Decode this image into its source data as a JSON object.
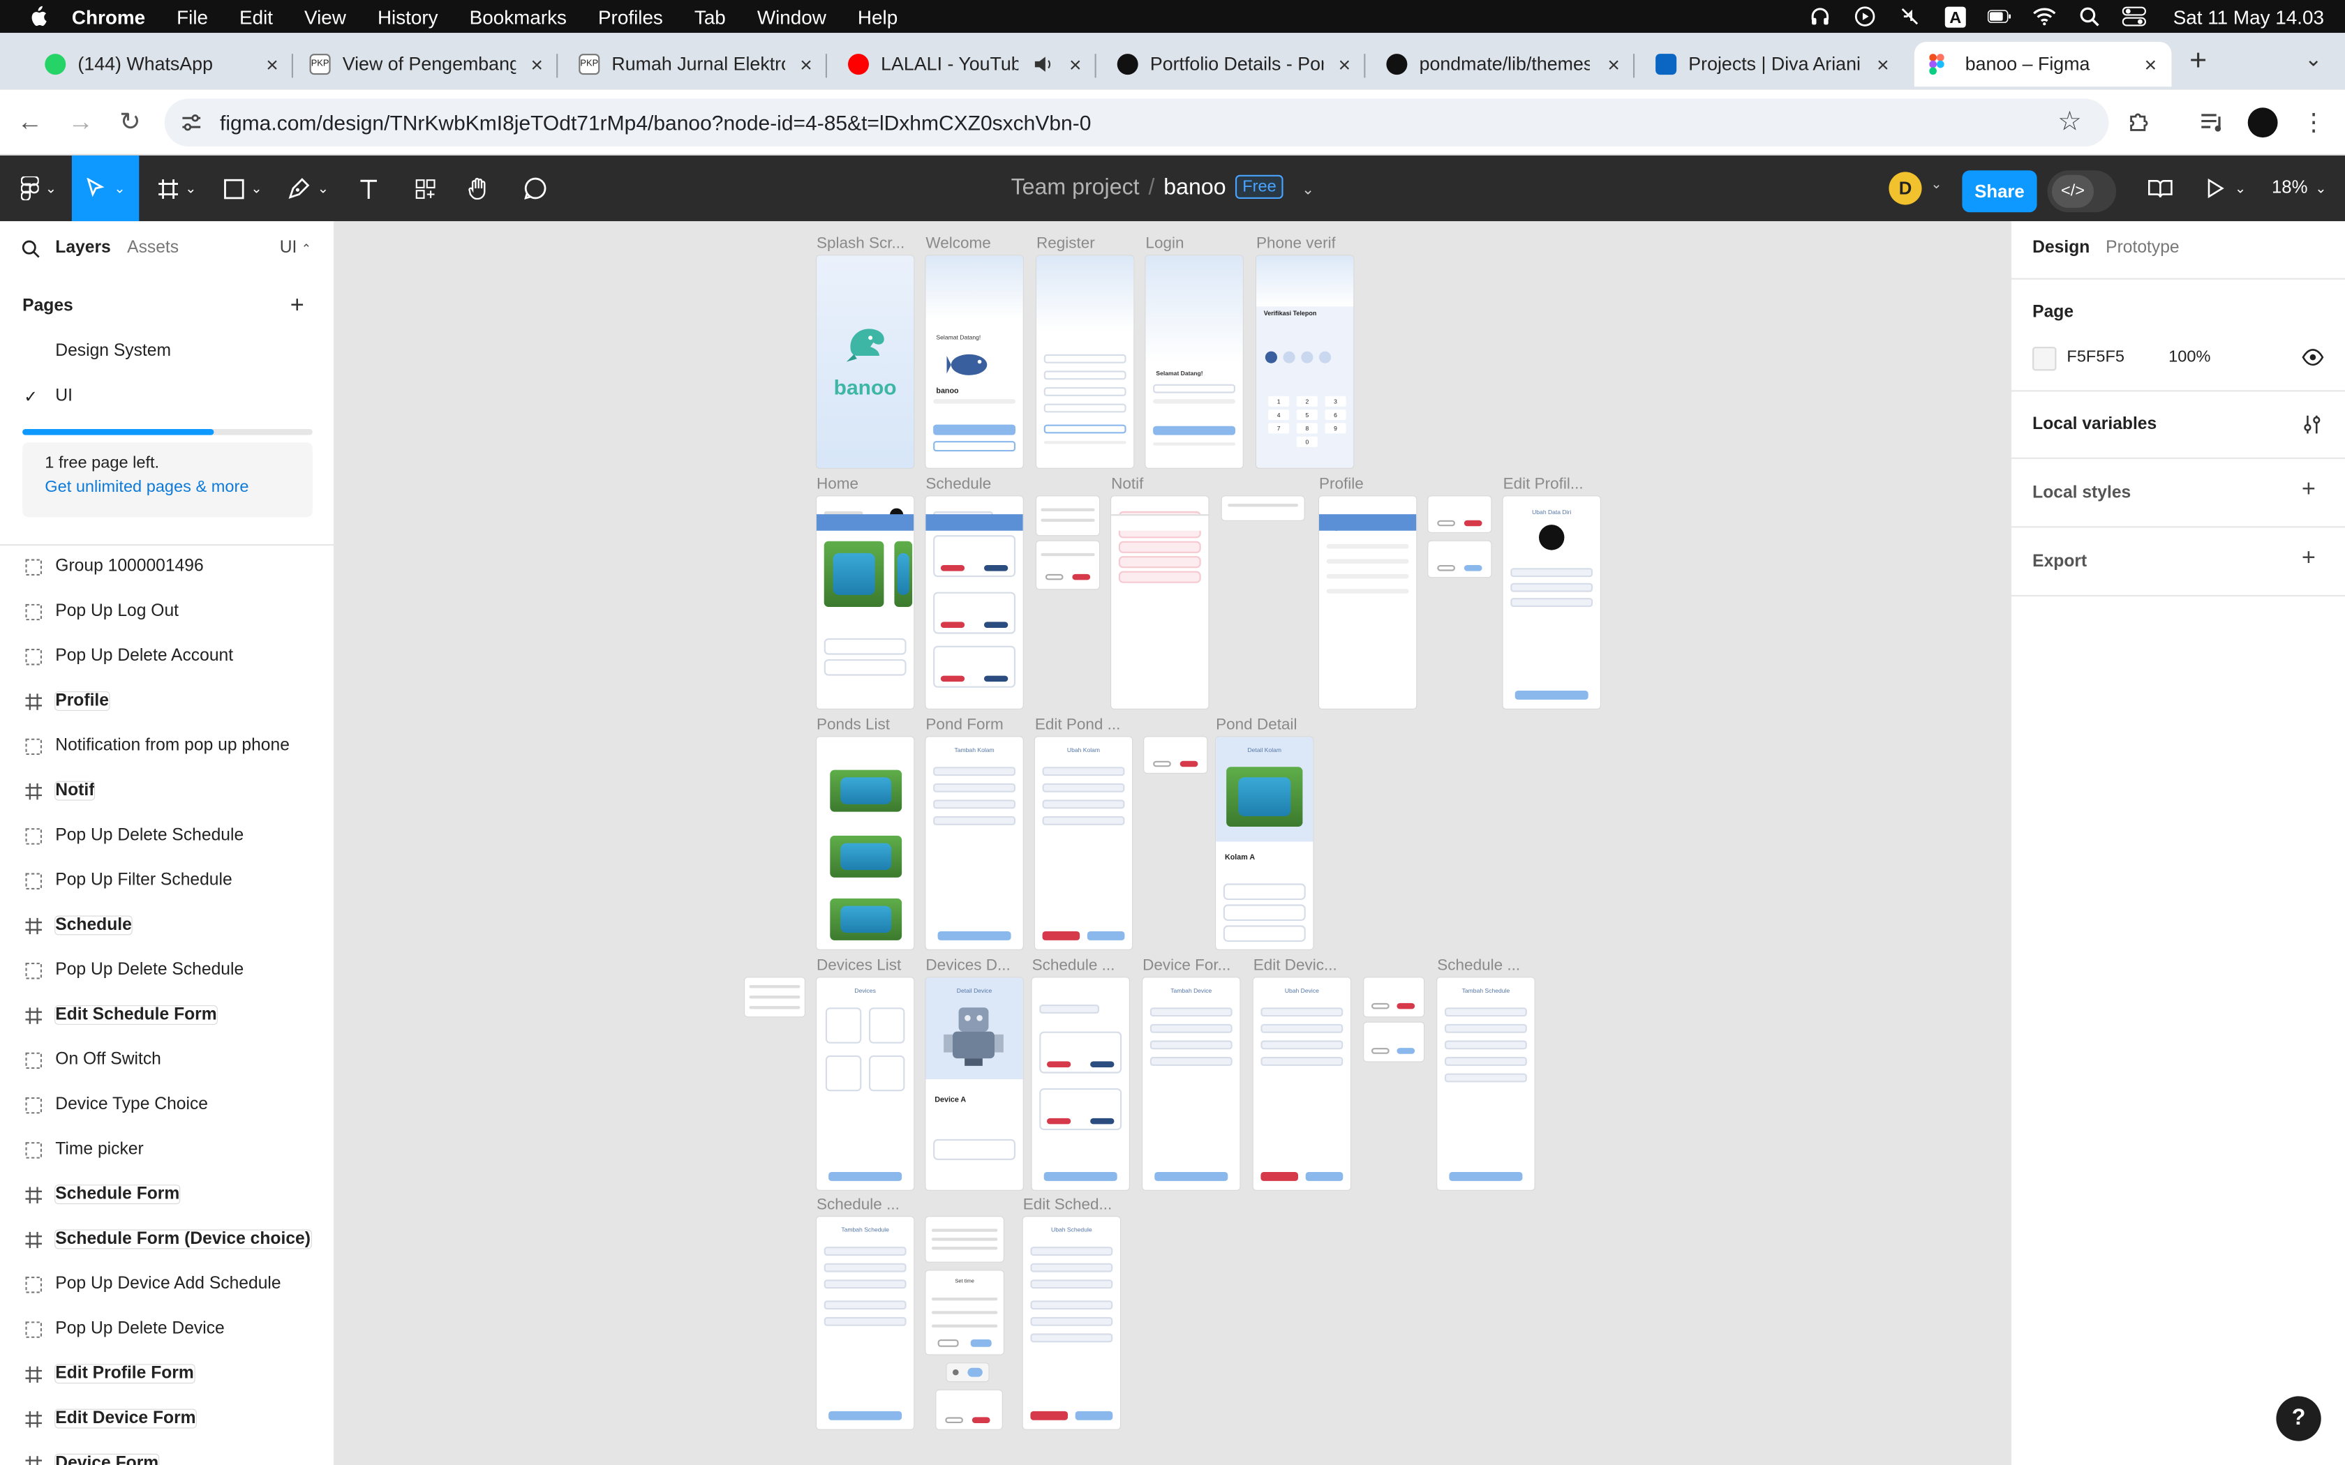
{
  "menubar": {
    "app": "Chrome",
    "items": [
      "File",
      "Edit",
      "View",
      "History",
      "Bookmarks",
      "Profiles",
      "Tab",
      "Window",
      "Help"
    ],
    "clock": "Sat 11 May  14.03",
    "status_icons": [
      "headphones-icon",
      "play-circle-icon",
      "mute-icon",
      "input-source-icon",
      "battery-icon",
      "wifi-icon",
      "spotlight-icon",
      "control-center-icon"
    ]
  },
  "tabs": [
    {
      "title": "(144) WhatsApp",
      "icon": "whatsapp-icon",
      "color": "#25d366"
    },
    {
      "title": "View of Pengembangan",
      "icon": "pkp-icon",
      "color": "#555555"
    },
    {
      "title": "Rumah Jurnal Elektronik",
      "icon": "pkp-icon",
      "color": "#555555"
    },
    {
      "title": "LALALI - YouTube",
      "icon": "youtube-icon",
      "color": "#ff0000"
    },
    {
      "title": "Portfolio Details - Portfolio",
      "icon": "portfolio-icon",
      "color": "#111111"
    },
    {
      "title": "pondmate/lib/themes/",
      "icon": "github-icon",
      "color": "#111111"
    },
    {
      "title": "Projects | Diva Ariani",
      "icon": "linkedin-icon",
      "color": "#0a66c2"
    },
    {
      "title": "banoo – Figma",
      "icon": "figma-icon",
      "color": "#f24e1e"
    }
  ],
  "address": {
    "url": "figma.com/design/TNrKwbKmI8jeTOdt71rMp4/banoo?node-id=4-85&t=lDxhmCXZ0sxchVbn-0"
  },
  "figma": {
    "team": "Team project",
    "file": "banoo",
    "plan_badge": "Free",
    "avatar_initial": "D",
    "share": "Share",
    "zoom": "18%"
  },
  "left_panel": {
    "tab_layers": "Layers",
    "tab_assets": "Assets",
    "page_switch": "UI",
    "pages_heading": "Pages",
    "pages": [
      "Design System",
      "UI"
    ],
    "current_page": "UI",
    "quota_fraction": 0.66,
    "free_note": "1 free page left.",
    "upgrade_link": "Get unlimited pages & more",
    "layers": [
      {
        "name": "Group 1000001496",
        "kind": "group"
      },
      {
        "name": "Pop Up Log Out",
        "kind": "group"
      },
      {
        "name": "Pop Up Delete Account",
        "kind": "group"
      },
      {
        "name": "Profile",
        "kind": "frame"
      },
      {
        "name": "Notification from pop up phone",
        "kind": "group"
      },
      {
        "name": "Notif",
        "kind": "frame"
      },
      {
        "name": "Pop Up Delete Schedule",
        "kind": "group"
      },
      {
        "name": "Pop Up Filter Schedule",
        "kind": "group"
      },
      {
        "name": "Schedule",
        "kind": "frame"
      },
      {
        "name": "Pop Up Delete Schedule",
        "kind": "group"
      },
      {
        "name": "Edit Schedule Form",
        "kind": "frame"
      },
      {
        "name": "On Off Switch",
        "kind": "group"
      },
      {
        "name": "Device Type Choice",
        "kind": "group"
      },
      {
        "name": "Time picker",
        "kind": "group"
      },
      {
        "name": "Schedule Form",
        "kind": "frame"
      },
      {
        "name": "Schedule Form (Device choice)",
        "kind": "frame"
      },
      {
        "name": "Pop Up Device Add Schedule",
        "kind": "group"
      },
      {
        "name": "Pop Up Delete Device",
        "kind": "group"
      },
      {
        "name": "Edit Profile Form",
        "kind": "frame"
      },
      {
        "name": "Edit Device Form",
        "kind": "frame"
      },
      {
        "name": "Device Form",
        "kind": "frame"
      }
    ]
  },
  "canvas": {
    "labels": {
      "splash": "Splash Scr...",
      "welcome": "Welcome",
      "register": "Register",
      "login": "Login",
      "phone": "Phone verif",
      "home": "Home",
      "schedule": "Schedule",
      "notif": "Notif",
      "profile": "Profile",
      "editprofile": "Edit Profil...",
      "ponds": "Ponds List",
      "pondform": "Pond Form",
      "editpond": "Edit Pond ...",
      "ponddetail": "Pond Detail",
      "deviceslist": "Devices List",
      "devicesd": "Devices D...",
      "schedule2": "Schedule ...",
      "deviceform": "Device For...",
      "editdevice": "Edit Devic...",
      "schedule3": "Schedule ...",
      "schedule4": "Schedule ...",
      "editsched": "Edit Sched..."
    },
    "logo_text": "banoo",
    "welcome_text": "Selamat Datang!",
    "phone_title": "Verifikasi Telepon",
    "keypad": [
      "1",
      "2",
      "3",
      "4",
      "5",
      "6",
      "7",
      "8",
      "9",
      "0"
    ],
    "pond_title": "Detail Kolam",
    "pond_name": "Kolam A",
    "device_name": "Device A",
    "edit_profile_title": "Ubah Data Diri",
    "add_pond_title": "Tambah Kolam",
    "edit_pond_title": "Ubah Kolam",
    "devices_title": "Devices",
    "device_detail_title": "Detail Device",
    "add_device_title": "Tambah Device",
    "edit_device_title": "Ubah Device",
    "add_schedule_title": "Tambah Schedule",
    "edit_schedule_title": "Ubah Schedule",
    "set_time_title": "Set time"
  },
  "right_panel": {
    "tab_design": "Design",
    "tab_prototype": "Prototype",
    "page_heading": "Page",
    "bg_hex": "F5F5F5",
    "bg_opacity": "100%",
    "local_variables": "Local variables",
    "local_styles": "Local styles",
    "export": "Export"
  },
  "colors": {
    "figma_blue": "#0d99ff",
    "toolbar_dark": "#2c2c2c",
    "canvas_bg": "#e5e5e5",
    "app_blue": "#5b8fd6"
  }
}
